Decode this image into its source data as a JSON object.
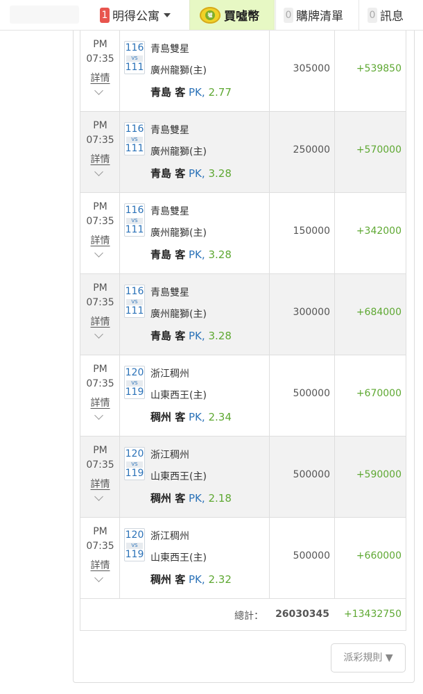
{
  "nav": {
    "house_count": "1",
    "house_label": "明得公寓",
    "buy_label": "買噓幣",
    "coin_glyph": "噓",
    "list_count": "0",
    "list_label": "購牌清單",
    "msg_count": "0",
    "msg_label": "訊息"
  },
  "rows": [
    {
      "ampm": "PM",
      "time": "07:35",
      "detail": "詳情",
      "score1": "116",
      "vs": "VS",
      "score2": "111",
      "team1": "青島雙星",
      "team2": "廣州龍獅(主)",
      "pick": "青島 客",
      "pk": "PK",
      "comma": ",",
      "odds": "2.77",
      "amount": "305000",
      "win": "+539850"
    },
    {
      "ampm": "PM",
      "time": "07:35",
      "detail": "詳情",
      "score1": "116",
      "vs": "VS",
      "score2": "111",
      "team1": "青島雙星",
      "team2": "廣州龍獅(主)",
      "pick": "青島 客",
      "pk": "PK",
      "comma": ",",
      "odds": "3.28",
      "amount": "250000",
      "win": "+570000"
    },
    {
      "ampm": "PM",
      "time": "07:35",
      "detail": "詳情",
      "score1": "116",
      "vs": "VS",
      "score2": "111",
      "team1": "青島雙星",
      "team2": "廣州龍獅(主)",
      "pick": "青島 客",
      "pk": "PK",
      "comma": ",",
      "odds": "3.28",
      "amount": "150000",
      "win": "+342000"
    },
    {
      "ampm": "PM",
      "time": "07:35",
      "detail": "詳情",
      "score1": "116",
      "vs": "VS",
      "score2": "111",
      "team1": "青島雙星",
      "team2": "廣州龍獅(主)",
      "pick": "青島 客",
      "pk": "PK",
      "comma": ",",
      "odds": "3.28",
      "amount": "300000",
      "win": "+684000"
    },
    {
      "ampm": "PM",
      "time": "07:35",
      "detail": "詳情",
      "score1": "120",
      "vs": "VS",
      "score2": "119",
      "team1": "浙江稠州",
      "team2": "山東西王(主)",
      "pick": "稠州 客",
      "pk": "PK",
      "comma": ",",
      "odds": "2.34",
      "amount": "500000",
      "win": "+670000"
    },
    {
      "ampm": "PM",
      "time": "07:35",
      "detail": "詳情",
      "score1": "120",
      "vs": "VS",
      "score2": "119",
      "team1": "浙江稠州",
      "team2": "山東西王(主)",
      "pick": "稠州 客",
      "pk": "PK",
      "comma": ",",
      "odds": "2.18",
      "amount": "500000",
      "win": "+590000"
    },
    {
      "ampm": "PM",
      "time": "07:35",
      "detail": "詳情",
      "score1": "120",
      "vs": "VS",
      "score2": "119",
      "team1": "浙江稠州",
      "team2": "山東西王(主)",
      "pick": "稠州 客",
      "pk": "PK",
      "comma": ",",
      "odds": "2.32",
      "amount": "500000",
      "win": "+660000"
    }
  ],
  "totals": {
    "label": "總計：",
    "amount": "26030345",
    "win": "+13432750"
  },
  "rules_button": "派彩規則 ▼",
  "colors": {
    "accent_green": "#5ea832",
    "link_blue": "#2b72b8",
    "nav_active_bg": "#e7f8c4",
    "badge_red": "#e8554e"
  }
}
